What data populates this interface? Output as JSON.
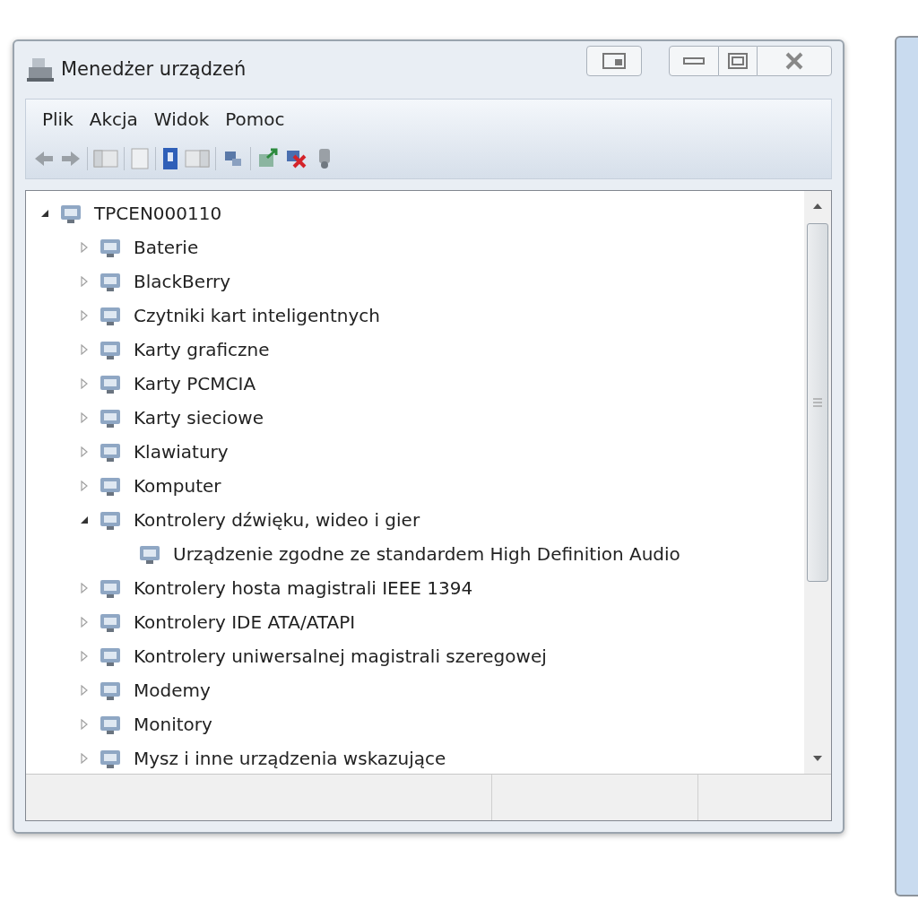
{
  "window": {
    "title": "Menedżer urządzeń"
  },
  "menu": [
    "Plik",
    "Akcja",
    "Widok",
    "Pomoc"
  ],
  "tree": {
    "label": "TPCEN000110",
    "expanded": true,
    "children": [
      {
        "label": "Baterie",
        "expanded": false
      },
      {
        "label": "BlackBerry",
        "expanded": false
      },
      {
        "label": "Czytniki kart inteligentnych",
        "expanded": false
      },
      {
        "label": "Karty graficzne",
        "expanded": false
      },
      {
        "label": "Karty PCMCIA",
        "expanded": false
      },
      {
        "label": "Karty sieciowe",
        "expanded": false
      },
      {
        "label": "Klawiatury",
        "expanded": false
      },
      {
        "label": "Komputer",
        "expanded": false
      },
      {
        "label": "Kontrolery dźwięku, wideo i gier",
        "expanded": true,
        "children": [
          {
            "label": "Urządzenie zgodne ze standardem High Definition Audio"
          }
        ]
      },
      {
        "label": "Kontrolery hosta magistrali IEEE 1394",
        "expanded": false
      },
      {
        "label": "Kontrolery IDE ATA/ATAPI",
        "expanded": false
      },
      {
        "label": "Kontrolery uniwersalnej magistrali szeregowej",
        "expanded": false
      },
      {
        "label": "Modemy",
        "expanded": false
      },
      {
        "label": "Monitory",
        "expanded": false
      },
      {
        "label": "Mysz i inne urządzenia wskazujące",
        "expanded": false
      }
    ]
  }
}
